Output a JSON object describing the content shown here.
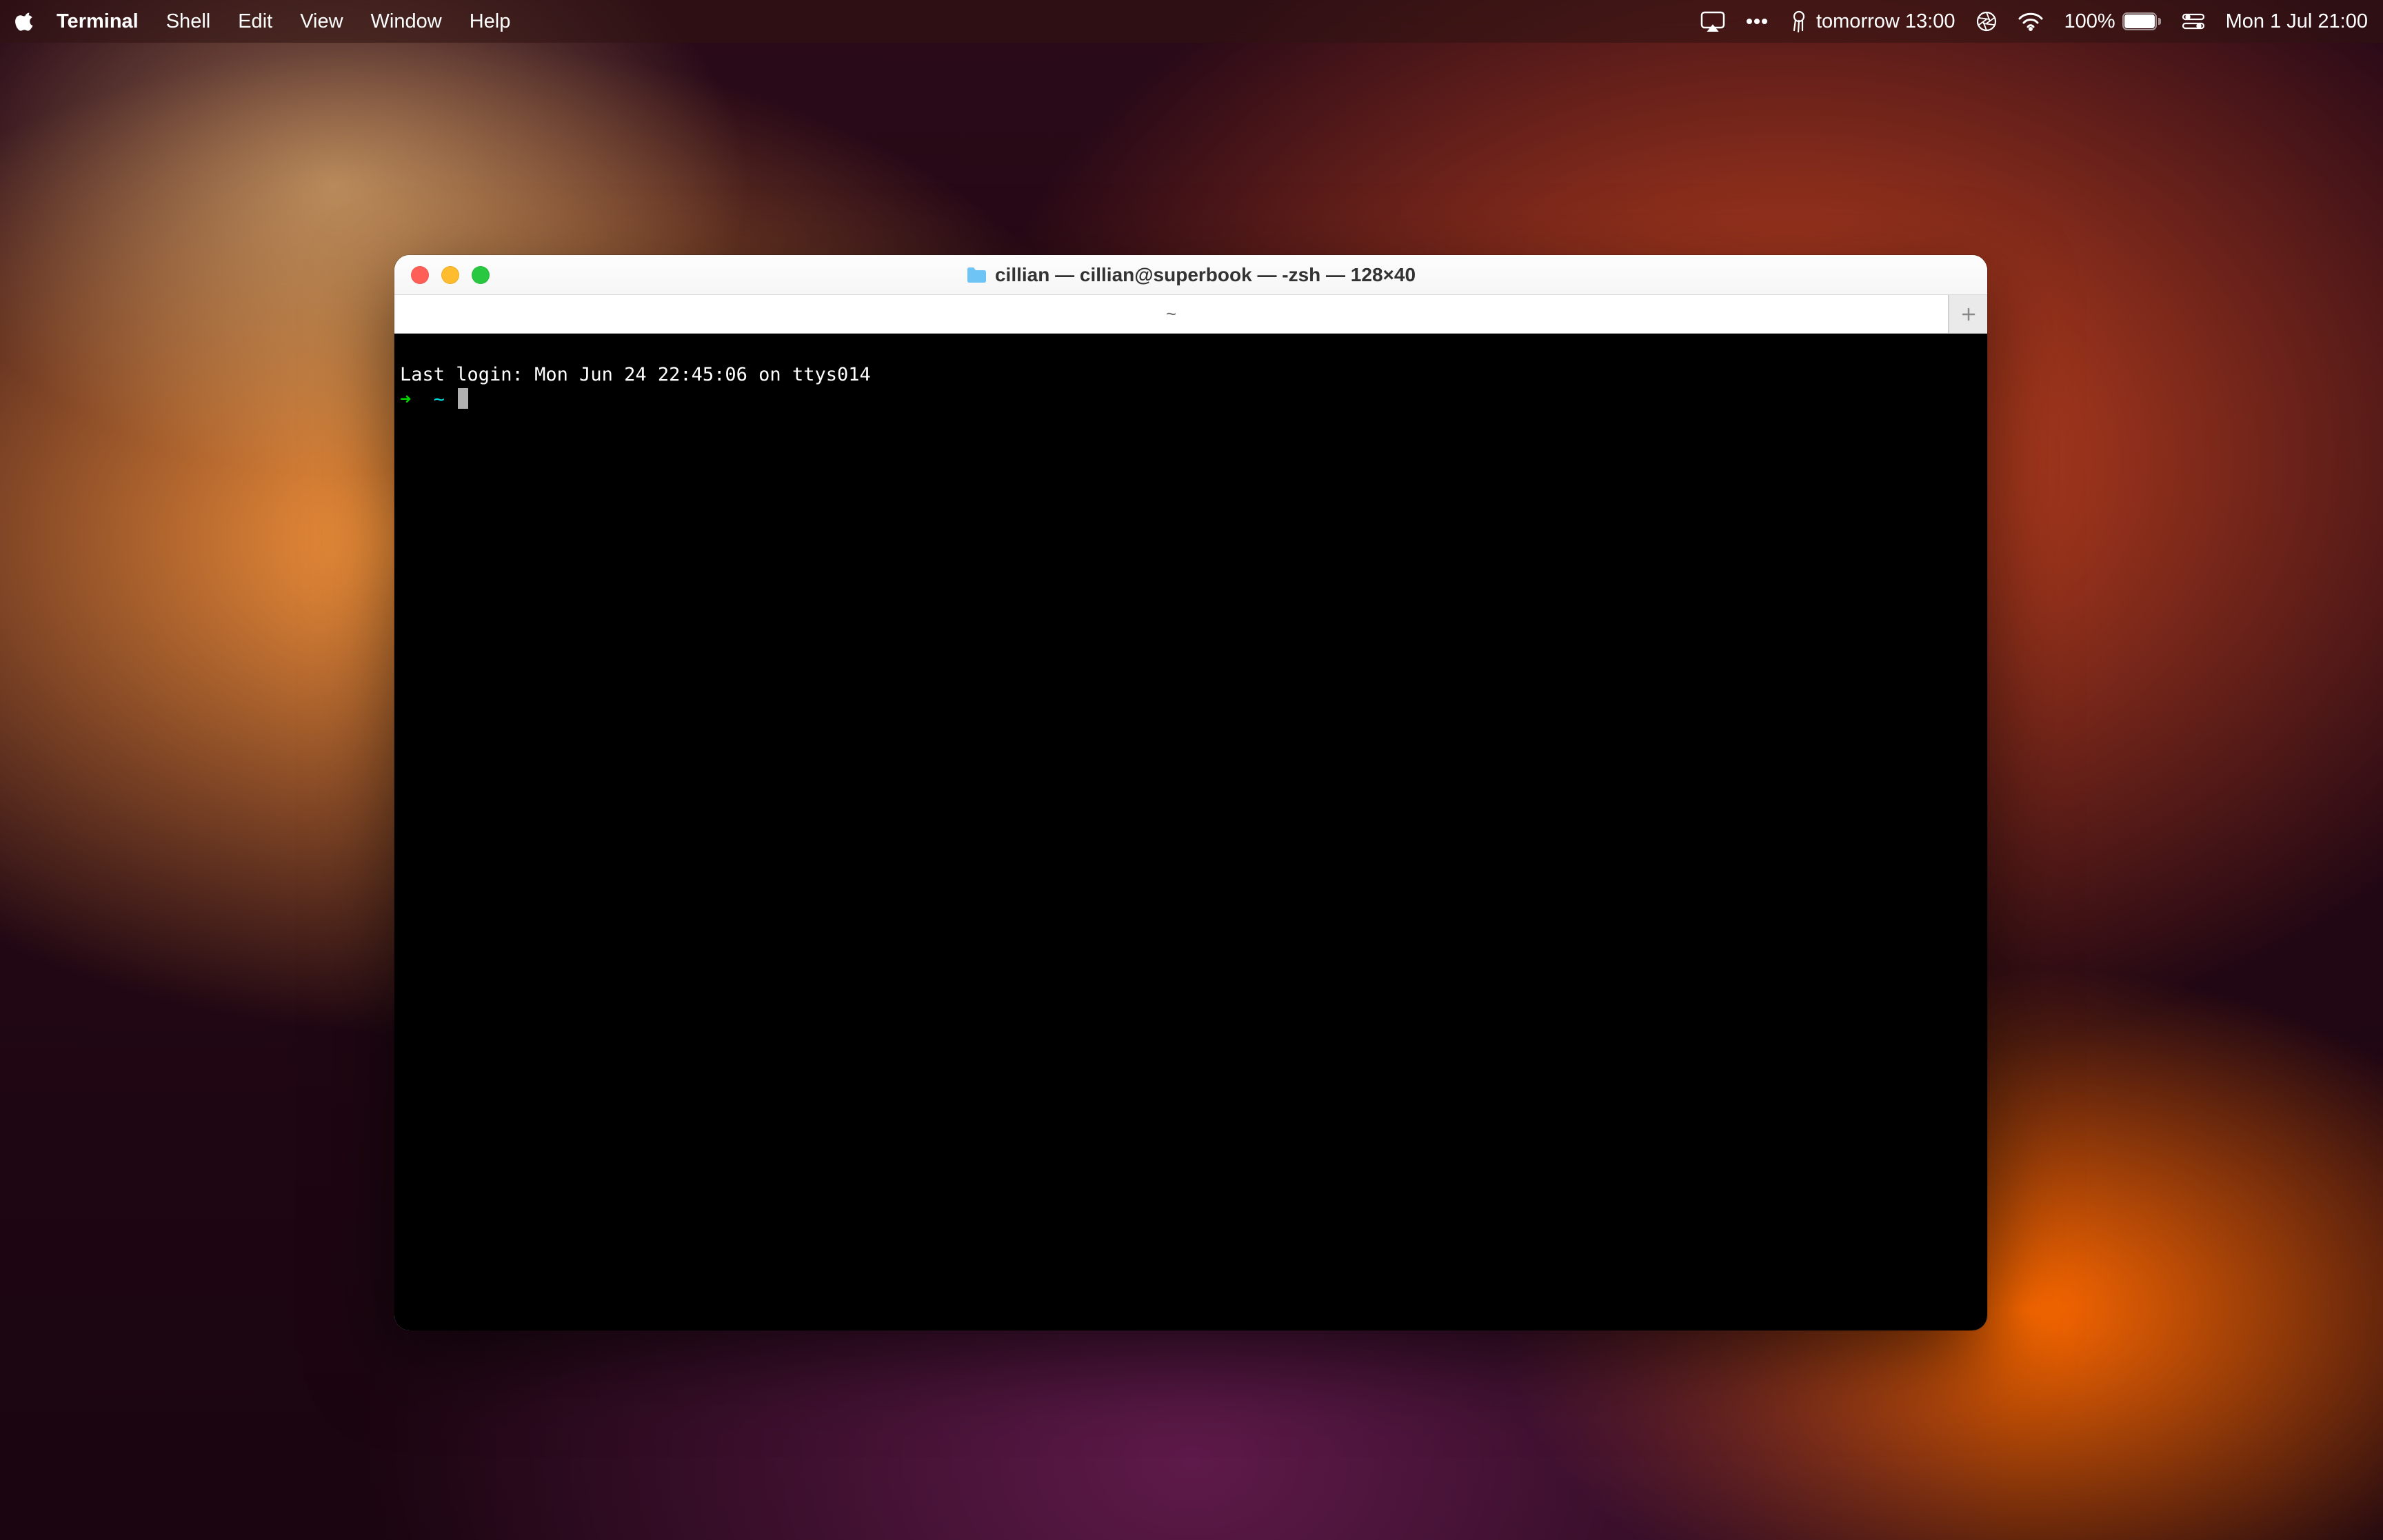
{
  "menubar": {
    "app_name": "Terminal",
    "menus": [
      "Shell",
      "Edit",
      "View",
      "Window",
      "Help"
    ],
    "status": {
      "weather_text": "tomorrow 13:00",
      "battery_pct": "100%",
      "clock": "Mon 1 Jul  21:00"
    }
  },
  "window": {
    "title": "cillian — cillian@superbook — -zsh — 128×40",
    "tabs": {
      "active_label": "~"
    },
    "terminal": {
      "last_login": "Last login: Mon Jun 24 22:45:06 on ttys014",
      "prompt_arrow": "➜",
      "prompt_path": "~"
    }
  }
}
